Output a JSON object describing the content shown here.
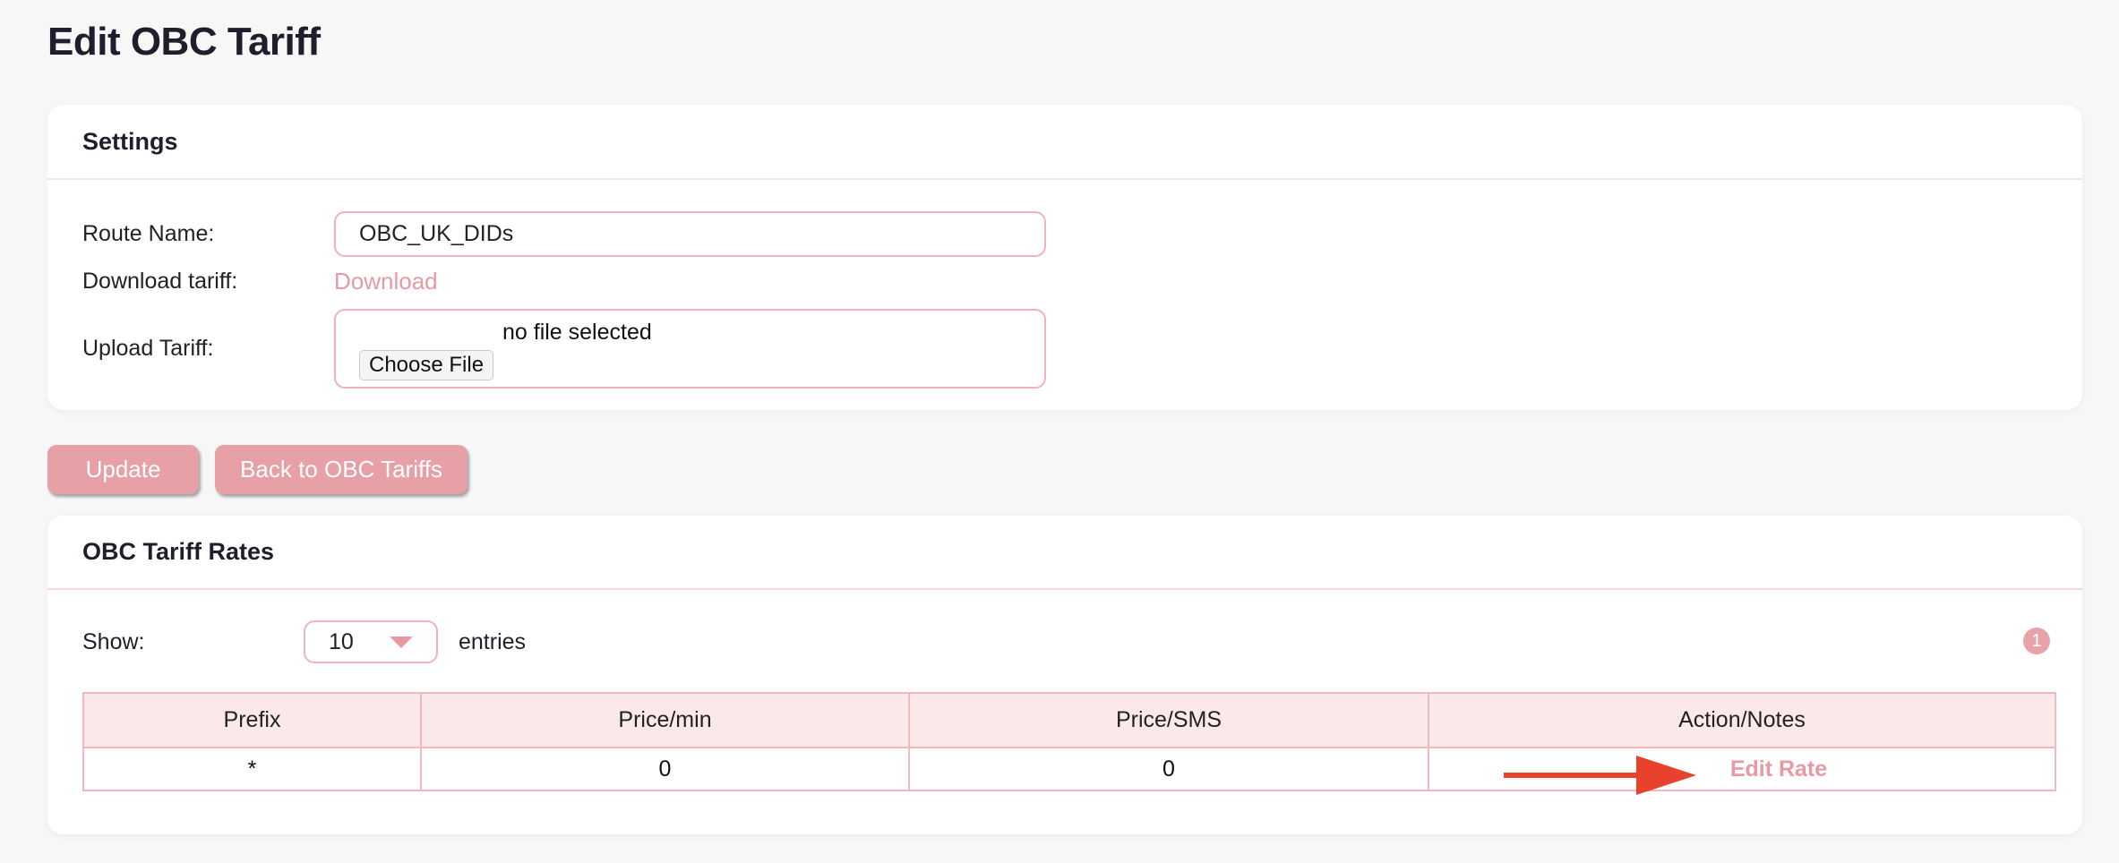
{
  "page": {
    "title": "Edit OBC Tariff"
  },
  "settings": {
    "header": "Settings",
    "route_name_label": "Route Name:",
    "route_name_value": "OBC_UK_DIDs",
    "download_label": "Download tariff:",
    "download_link": "Download",
    "upload_label": "Upload Tariff:",
    "file_status": "no file selected",
    "choose_file_label": "Choose File"
  },
  "actions": {
    "update_label": "Update",
    "back_label": "Back to OBC Tariffs"
  },
  "rates": {
    "header": "OBC Tariff Rates",
    "show_label": "Show:",
    "page_size": "10",
    "entries_label": "entries",
    "page_number": "1",
    "columns": [
      "Prefix",
      "Price/min",
      "Price/SMS",
      "Action/Notes"
    ],
    "rows": [
      {
        "prefix": "*",
        "price_min": "0",
        "price_sms": "0",
        "action": "Edit Rate"
      }
    ]
  },
  "colors": {
    "accent": "#e7a0a6",
    "annotation_arrow": "#e8412c"
  },
  "icons": [
    "caret-down-icon",
    "arrow-right-icon"
  ]
}
